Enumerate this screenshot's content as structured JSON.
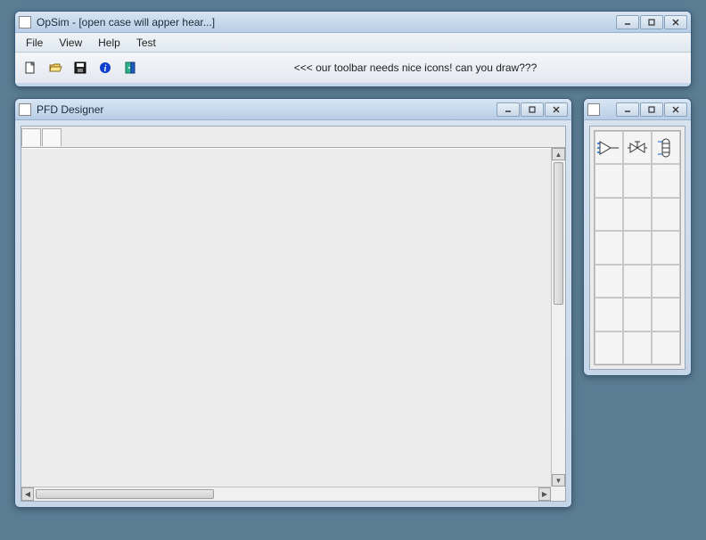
{
  "main_window": {
    "title": "OpSim - [open case will apper hear...]",
    "menus": [
      "File",
      "View",
      "Help",
      "Test"
    ],
    "toolbar_message": "<<< our toolbar needs nice icons! can you draw???",
    "toolbar_icons": [
      "new",
      "open",
      "save",
      "info",
      "exit"
    ]
  },
  "pfd_window": {
    "title": "PFD Designer"
  },
  "palette_window": {
    "title": "",
    "items": [
      "mixer",
      "valve",
      "column"
    ]
  }
}
